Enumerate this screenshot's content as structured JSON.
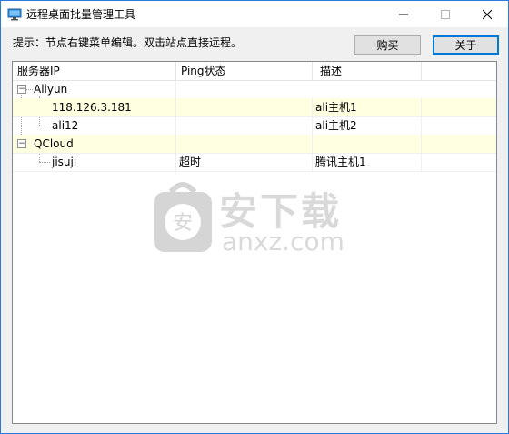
{
  "window": {
    "title": "远程桌面批量管理工具",
    "minimize_glyph": "—",
    "maximize_glyph": "☐",
    "close_glyph": "✕"
  },
  "hint": "提示：节点右键菜单编辑。双击站点直接远程。",
  "buttons": {
    "buy": "购买",
    "about": "关于"
  },
  "columns": [
    "服务器IP",
    "Ping状态",
    "描述",
    ""
  ],
  "tree": [
    {
      "name": "Aliyun",
      "expander": "−",
      "children": [
        {
          "ip": "118.126.3.181",
          "ping": "",
          "desc": "ali主机1"
        },
        {
          "ip": "ali12",
          "ping": "",
          "desc": "ali主机2"
        }
      ]
    },
    {
      "name": "QCloud",
      "expander": "−",
      "children": [
        {
          "ip": "jisuji",
          "ping": "超时",
          "desc": "腾讯主机1"
        }
      ]
    }
  ],
  "watermark": {
    "cn": "安下载",
    "en": "anxz.com",
    "logo_char": "安"
  },
  "colors": {
    "highlight_row": "#ffffe1",
    "focus_border": "#0078d7",
    "window_border": "#2b79d8"
  },
  "icons": {
    "app": "monitor-icon",
    "watermark": "shield-bag-icon"
  }
}
